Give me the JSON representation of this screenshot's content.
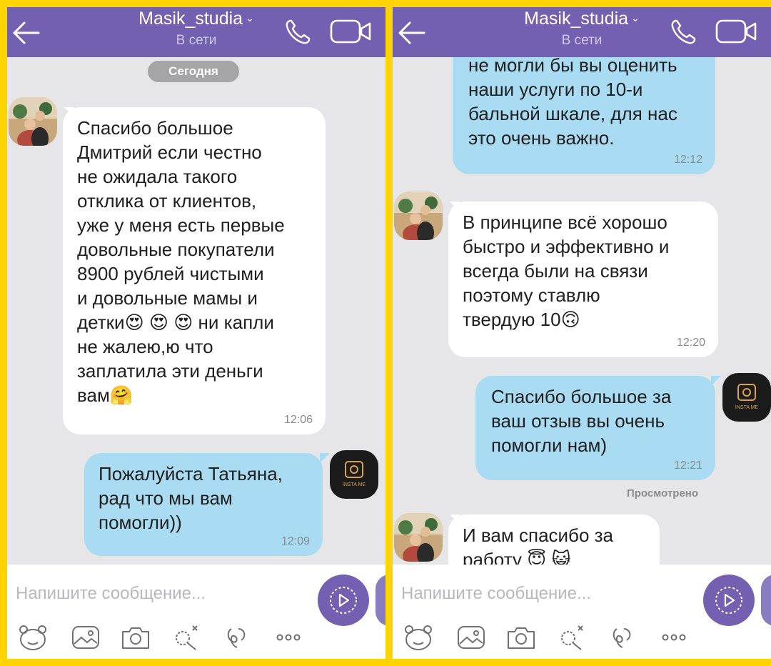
{
  "colors": {
    "header": "#7360b1",
    "bubble_in": "#ffffff",
    "bubble_out": "#a9dcf2",
    "background": "#e6e6e9",
    "frame": "#ffd400"
  },
  "left": {
    "header": {
      "title": "Masik_studia",
      "status": "В сети"
    },
    "date_label": "Сегодня",
    "messages": [
      {
        "from": "contact",
        "text": "Спасибо большое\nДмитрий если честно\nне ожидала такого\nотклика от клиентов,\nуже у меня есть первые\nдовольные покупатели\n8900 рублей чистыми\nи довольные мамы и\nдетки😍 😍 😍  ни капли\nне жалею,ю что\nзаплатила эти деньги\nвам🤗",
        "time": "12:06"
      },
      {
        "from": "me",
        "text": "Пожалуйста Татьяна,\nрад что мы вам\nпомогли))",
        "time": "12:09"
      }
    ],
    "composer": {
      "placeholder": "Напишите сообщение..."
    }
  },
  "right": {
    "header": {
      "title": "Masik_studia",
      "status": "В сети"
    },
    "messages": [
      {
        "from": "me",
        "text": "не могли бы вы оценить\nнаши услуги по 10-и\nбальной шкале, для нас\nэто очень важно.",
        "time": "12:12"
      },
      {
        "from": "contact",
        "text": "В принципе всё хорошо\nбыстро и эффективно и\nвсегда были на связи\nпоэтому ставлю\nтвердую 10🙃",
        "time": "12:20"
      },
      {
        "from": "me",
        "text": "Спасибо большое за\nваш отзыв  вы очень\nпомогли нам)",
        "time": "12:21"
      },
      {
        "from": "contact",
        "text": "И вам спасибо за\nработу 😇 😺",
        "time": ""
      }
    ],
    "seen_label": "Просмотрено",
    "composer": {
      "placeholder": "Напишите сообщение..."
    }
  },
  "insta_logo_text": "INSTA ME",
  "icons": [
    "back-arrow-icon",
    "chevron-down-icon",
    "phone-icon",
    "video-camera-icon",
    "send-icon",
    "sticker-icon",
    "gallery-icon",
    "camera-icon",
    "doodle-icon",
    "gif-icon",
    "more-icon"
  ]
}
